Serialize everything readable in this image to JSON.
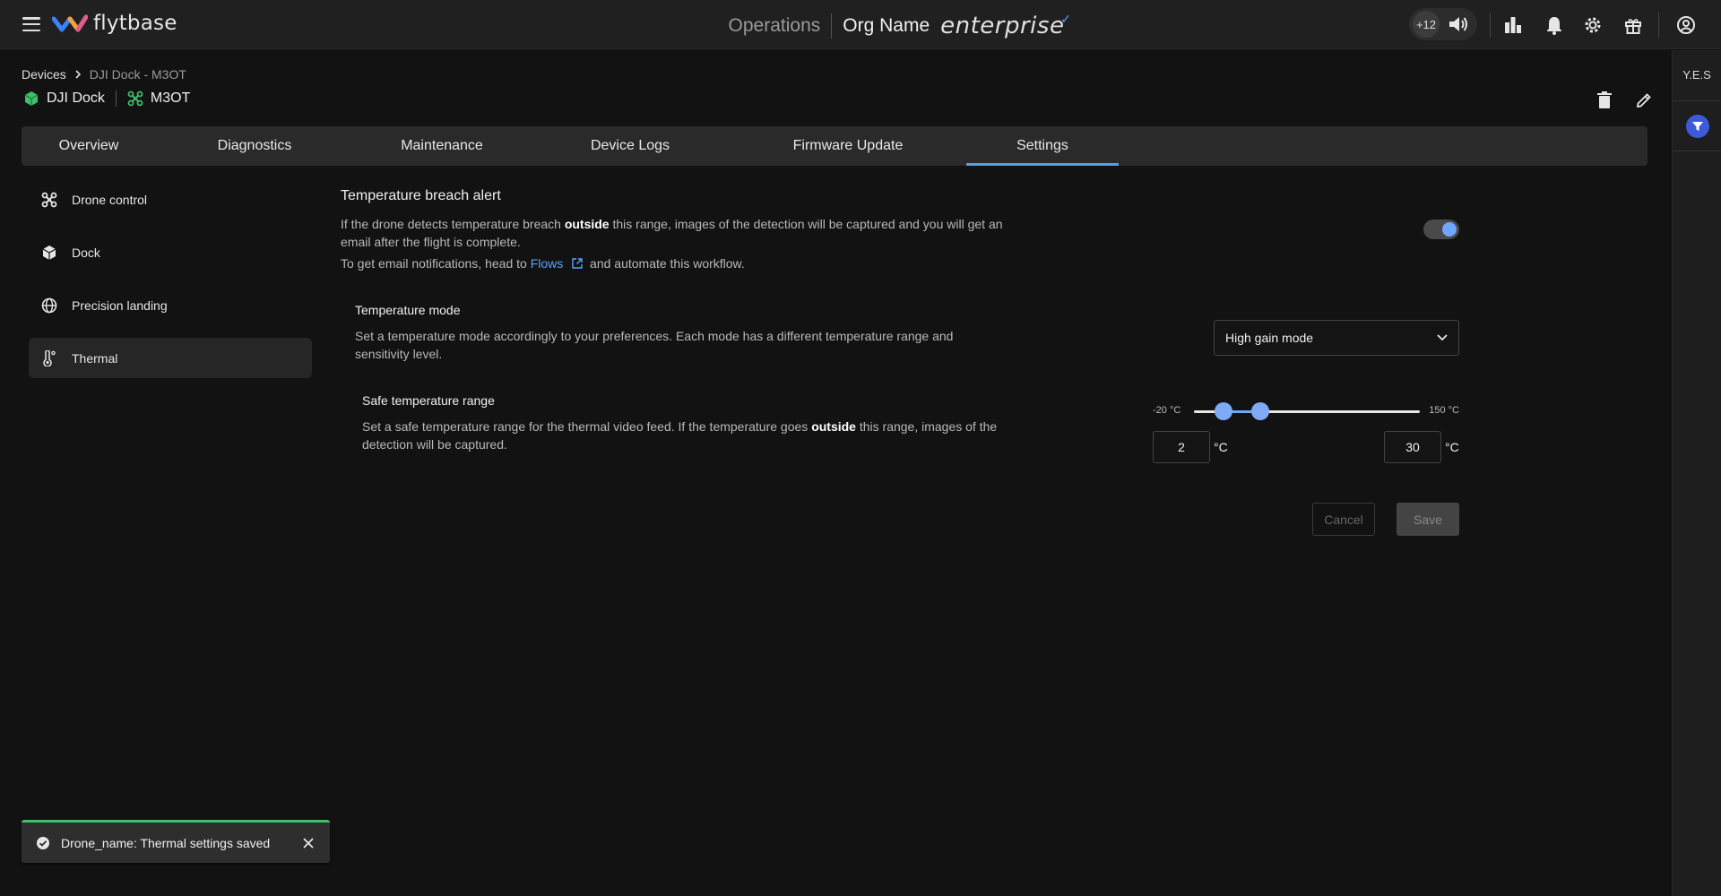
{
  "topbar": {
    "logo_text": "flytbase",
    "section": "Operations",
    "org_name": "Org Name",
    "plan": "enterprise",
    "volume_badge": "+12",
    "icons": [
      "volume-icon",
      "chart-icon",
      "bell-icon",
      "gear-icon",
      "gift-icon",
      "account-icon"
    ]
  },
  "rightrail": {
    "label": "Y.E.S"
  },
  "breadcrumb": {
    "root": "Devices",
    "current": "DJI Dock - M3OT"
  },
  "device": {
    "dock_name": "DJI Dock",
    "drone_name": "M3OT"
  },
  "tabs": [
    {
      "label": "Overview"
    },
    {
      "label": "Diagnostics"
    },
    {
      "label": "Maintenance"
    },
    {
      "label": "Device Logs"
    },
    {
      "label": "Firmware Update"
    },
    {
      "label": "Settings"
    }
  ],
  "active_tab": "Settings",
  "sidebar": {
    "items": [
      {
        "label": "Drone control",
        "icon": "drone-icon"
      },
      {
        "label": "Dock",
        "icon": "cube-icon"
      },
      {
        "label": "Precision landing",
        "icon": "globe-icon"
      },
      {
        "label": "Thermal",
        "icon": "thermometer-icon"
      }
    ],
    "active": "Thermal"
  },
  "breach_alert": {
    "title": "Temperature breach alert",
    "desc_part1": "If the drone detects temperature breach ",
    "desc_bold": "outside",
    "desc_part2": " this range, images of the detection will be captured and you will get an email after the flight is complete.",
    "notify_part1": "To get email notifications, head to ",
    "notify_link": "Flows",
    "notify_part2": " and automate this workflow.",
    "enabled": true
  },
  "temperature_mode": {
    "title": "Temperature mode",
    "desc": "Set a temperature mode accordingly to your preferences. Each mode has a different temperature range and sensitivity level.",
    "selected": "High gain mode"
  },
  "safe_range": {
    "title": "Safe temperature range",
    "desc_part1": "Set a safe temperature range for the thermal video feed. If the temperature goes ",
    "desc_bold": "outside",
    "desc_part2": " this range, images of the detection will be captured.",
    "min_label": "-20 °C",
    "max_label": "150 °C",
    "min_value": -20,
    "max_value": 150,
    "low": "2",
    "high": "30",
    "unit": "°C"
  },
  "actions": {
    "cancel": "Cancel",
    "save": "Save"
  },
  "toast": {
    "message": "Drone_name: Thermal settings saved"
  },
  "colors": {
    "accent": "#5a9bf0",
    "success": "#3fbf6a",
    "link": "#5aa2ff",
    "dock_green": "#3fbf6a"
  }
}
